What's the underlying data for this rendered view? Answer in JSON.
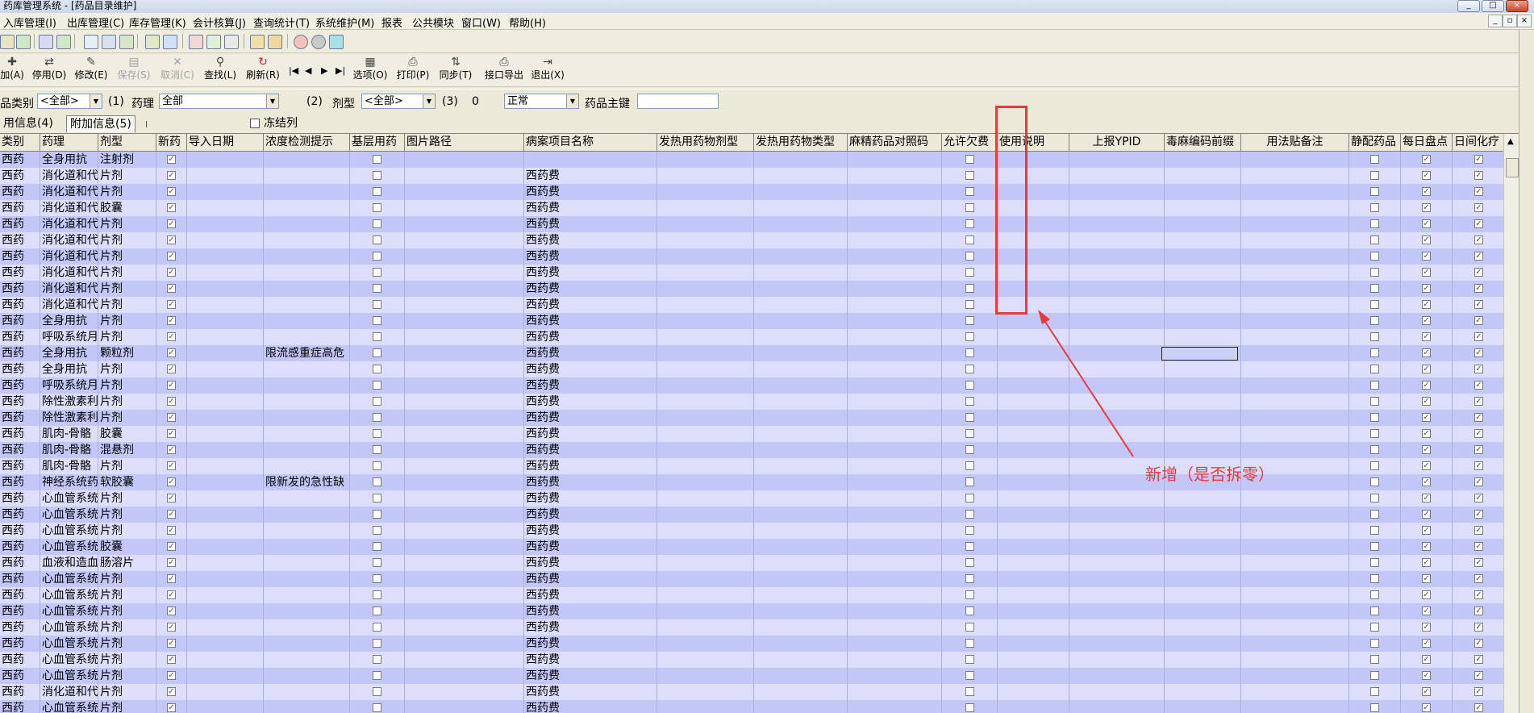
{
  "window": {
    "title": "药库管理系统 - [药品目录维护]",
    "controls": [
      "_",
      "□",
      "×"
    ]
  },
  "menu": {
    "items": [
      "入库管理(I)",
      "出库管理(C)",
      "库存管理(K)",
      "会计核算(J)",
      "查询统计(T)",
      "系统维护(M)",
      "报表",
      "公共模块",
      "窗口(W)",
      "帮助(H)"
    ],
    "mdi_controls": [
      "_",
      "▫",
      "×"
    ]
  },
  "toolbar2": {
    "buttons": [
      {
        "label": "加(A)",
        "icon": "add-icon",
        "enabled": true
      },
      {
        "label": "停用(D)",
        "icon": "disable-icon",
        "enabled": true
      },
      {
        "label": "修改(E)",
        "icon": "edit-icon",
        "enabled": true
      },
      {
        "label": "保存(S)",
        "icon": "save-icon",
        "enabled": false
      },
      {
        "label": "取消(C)",
        "icon": "cancel-icon",
        "enabled": false
      },
      {
        "label": "查找(L)",
        "icon": "search-icon",
        "enabled": true
      },
      {
        "label": "刷新(R)",
        "icon": "refresh-icon",
        "enabled": true
      },
      {
        "label": "选项(O)",
        "icon": "options-icon",
        "enabled": true
      },
      {
        "label": "打印(P)",
        "icon": "print-icon",
        "enabled": true
      },
      {
        "label": "同步(T)",
        "icon": "sync-icon",
        "enabled": true
      },
      {
        "label": "接口导出",
        "icon": "export-icon",
        "enabled": true
      },
      {
        "label": "退出(X)",
        "icon": "exit-icon",
        "enabled": true
      }
    ],
    "nav": [
      "|◀",
      "◀",
      "▶",
      "▶|"
    ]
  },
  "filter": {
    "category_label": "品类别",
    "category_value": "<全部>",
    "num1": "(1)",
    "pharm_label": "药理",
    "pharm_value": "全部",
    "num2": "(2)",
    "form_label": "剂型",
    "form_value": "<全部>",
    "num3": "(3)",
    "zero": "0",
    "status_value": "正常",
    "key_label": "药品主键",
    "key_value": ""
  },
  "tabs": {
    "items": [
      "用信息(4)",
      "附加信息(5)"
    ],
    "active": 1,
    "freeze_label": "冻结列"
  },
  "grid": {
    "columns": [
      "类别",
      "药理",
      "剂型",
      "新药",
      "导入日期",
      "浓度检测提示",
      "基层用药",
      "图片路径",
      "病案项目名称",
      "发热用药物剂型",
      "发热用药物类型",
      "麻精药品对照码",
      "允许欠费",
      "使用说明",
      "上报YPID",
      "毒麻编码前缀",
      "用法贴备注",
      "静配药品",
      "每日盘点",
      "日间化疗"
    ],
    "rows": [
      {
        "cat": "西药",
        "pharm": "全身用抗",
        "form": "注射剂",
        "hint": "",
        "case": ""
      },
      {
        "cat": "西药",
        "pharm": "消化道和代",
        "form": "片剂",
        "hint": "",
        "case": "西药费"
      },
      {
        "cat": "西药",
        "pharm": "消化道和代",
        "form": "片剂",
        "hint": "",
        "case": "西药费"
      },
      {
        "cat": "西药",
        "pharm": "消化道和代",
        "form": "胶囊",
        "hint": "",
        "case": "西药费"
      },
      {
        "cat": "西药",
        "pharm": "消化道和代",
        "form": "片剂",
        "hint": "",
        "case": "西药费"
      },
      {
        "cat": "西药",
        "pharm": "消化道和代",
        "form": "片剂",
        "hint": "",
        "case": "西药费"
      },
      {
        "cat": "西药",
        "pharm": "消化道和代",
        "form": "片剂",
        "hint": "",
        "case": "西药费"
      },
      {
        "cat": "西药",
        "pharm": "消化道和代",
        "form": "片剂",
        "hint": "",
        "case": "西药费"
      },
      {
        "cat": "西药",
        "pharm": "消化道和代",
        "form": "片剂",
        "hint": "",
        "case": "西药费"
      },
      {
        "cat": "西药",
        "pharm": "消化道和代",
        "form": "片剂",
        "hint": "",
        "case": "西药费"
      },
      {
        "cat": "西药",
        "pharm": "全身用抗",
        "form": "片剂",
        "hint": "",
        "case": "西药费"
      },
      {
        "cat": "西药",
        "pharm": "呼吸系统月",
        "form": "片剂",
        "hint": "",
        "case": "西药费"
      },
      {
        "cat": "西药",
        "pharm": "全身用抗",
        "form": "颗粒剂",
        "hint": "限流感重症高危",
        "case": "西药费"
      },
      {
        "cat": "西药",
        "pharm": "全身用抗",
        "form": "片剂",
        "hint": "",
        "case": "西药费"
      },
      {
        "cat": "西药",
        "pharm": "呼吸系统月",
        "form": "片剂",
        "hint": "",
        "case": "西药费"
      },
      {
        "cat": "西药",
        "pharm": "除性激素利",
        "form": "片剂",
        "hint": "",
        "case": "西药费"
      },
      {
        "cat": "西药",
        "pharm": "除性激素利",
        "form": "片剂",
        "hint": "",
        "case": "西药费"
      },
      {
        "cat": "西药",
        "pharm": "肌肉-骨骼",
        "form": "胶囊",
        "hint": "",
        "case": "西药费"
      },
      {
        "cat": "西药",
        "pharm": "肌肉-骨骼",
        "form": "混悬剂",
        "hint": "",
        "case": "西药费"
      },
      {
        "cat": "西药",
        "pharm": "肌肉-骨骼",
        "form": "片剂",
        "hint": "",
        "case": "西药费"
      },
      {
        "cat": "西药",
        "pharm": "神经系统药",
        "form": "软胶囊",
        "hint": "限新发的急性缺",
        "case": "西药费"
      },
      {
        "cat": "西药",
        "pharm": "心血管系统",
        "form": "片剂",
        "hint": "",
        "case": "西药费"
      },
      {
        "cat": "西药",
        "pharm": "心血管系统",
        "form": "片剂",
        "hint": "",
        "case": "西药费"
      },
      {
        "cat": "西药",
        "pharm": "心血管系统",
        "form": "片剂",
        "hint": "",
        "case": "西药费"
      },
      {
        "cat": "西药",
        "pharm": "心血管系统",
        "form": "胶囊",
        "hint": "",
        "case": "西药费"
      },
      {
        "cat": "西药",
        "pharm": "血液和造血",
        "form": "肠溶片",
        "hint": "",
        "case": "西药费"
      },
      {
        "cat": "西药",
        "pharm": "心血管系统",
        "form": "片剂",
        "hint": "",
        "case": "西药费"
      },
      {
        "cat": "西药",
        "pharm": "心血管系统",
        "form": "片剂",
        "hint": "",
        "case": "西药费"
      },
      {
        "cat": "西药",
        "pharm": "心血管系统",
        "form": "片剂",
        "hint": "",
        "case": "西药费"
      },
      {
        "cat": "西药",
        "pharm": "心血管系统",
        "form": "片剂",
        "hint": "",
        "case": "西药费"
      },
      {
        "cat": "西药",
        "pharm": "心血管系统",
        "form": "片剂",
        "hint": "",
        "case": "西药费"
      },
      {
        "cat": "西药",
        "pharm": "心血管系统",
        "form": "片剂",
        "hint": "",
        "case": "西药费"
      },
      {
        "cat": "西药",
        "pharm": "心血管系统",
        "form": "片剂",
        "hint": "",
        "case": "西药费"
      },
      {
        "cat": "西药",
        "pharm": "消化道和代",
        "form": "片剂",
        "hint": "",
        "case": "西药费"
      },
      {
        "cat": "西药",
        "pharm": "心血管系统",
        "form": "片剂",
        "hint": "",
        "case": "西药费"
      }
    ]
  },
  "annotation": {
    "text": "新增（是否拆零）",
    "color": "#e83a3a"
  }
}
